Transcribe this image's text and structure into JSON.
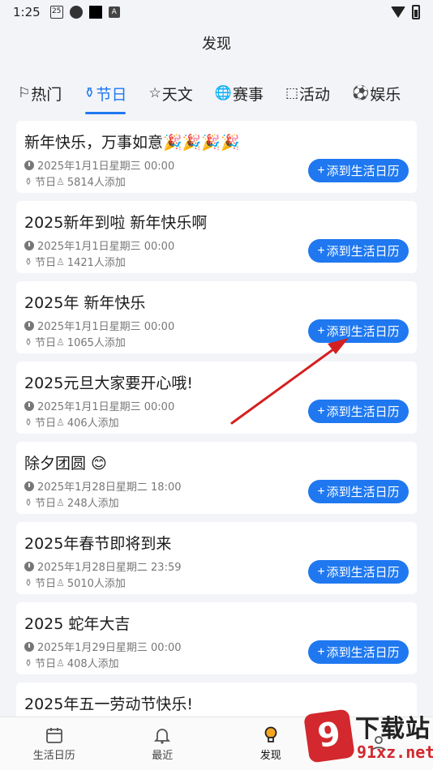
{
  "status_bar": {
    "time": "1:25",
    "cal_day": "25",
    "a_label": "A"
  },
  "page_title": "发现",
  "tabs": [
    {
      "icon": "⚐",
      "label": "热门",
      "icon_name": "flag-icon"
    },
    {
      "icon": "⚱",
      "label": "节日",
      "icon_name": "lantern-icon",
      "active": true
    },
    {
      "icon": "☆",
      "label": "天文",
      "icon_name": "star-icon"
    },
    {
      "icon": "🌐",
      "label": "赛事",
      "icon_name": "globe-icon"
    },
    {
      "icon": "⬚",
      "label": "活动",
      "icon_name": "ticket-icon"
    },
    {
      "icon": "⚽",
      "label": "娱乐",
      "icon_name": "ball-icon"
    }
  ],
  "events": [
    {
      "title": "新年快乐，万事如意🎉🎉🎉🎉",
      "time": "2025年1月1日星期三 00:00",
      "category": "节日",
      "count": "5814人添加"
    },
    {
      "title": "2025新年到啦 新年快乐啊",
      "time": "2025年1月1日星期三 00:00",
      "category": "节日",
      "count": "1421人添加"
    },
    {
      "title": "2025年 新年快乐",
      "time": "2025年1月1日星期三 00:00",
      "category": "节日",
      "count": "1065人添加"
    },
    {
      "title": "2025元旦大家要开心哦!",
      "time": "2025年1月1日星期三 00:00",
      "category": "节日",
      "count": "406人添加"
    },
    {
      "title": "除夕团圆 😊",
      "time": "2025年1月28日星期二 18:00",
      "category": "节日",
      "count": "248人添加"
    },
    {
      "title": "2025年春节即将到来",
      "time": "2025年1月28日星期二 23:59",
      "category": "节日",
      "count": "5010人添加"
    },
    {
      "title": "2025 蛇年大吉",
      "time": "2025年1月29日星期三 00:00",
      "category": "节日",
      "count": "408人添加"
    },
    {
      "title": "2025年五一劳动节快乐!",
      "time": "",
      "category": "",
      "count": ""
    }
  ],
  "add_button_label": "添到生活日历",
  "bottom_nav": [
    {
      "label": "生活日历",
      "icon_name": "calendar-icon"
    },
    {
      "label": "最近",
      "icon_name": "bell-icon"
    },
    {
      "label": "发现",
      "icon_name": "lightbulb-icon",
      "active": true
    },
    {
      "label": "",
      "icon_name": "person-icon"
    }
  ],
  "watermark": {
    "badge": "9",
    "text_top": "下载站",
    "text_bottom": "91xz.net"
  },
  "colors": {
    "accent": "#1f78f0",
    "annotation_arrow": "#d42020"
  }
}
